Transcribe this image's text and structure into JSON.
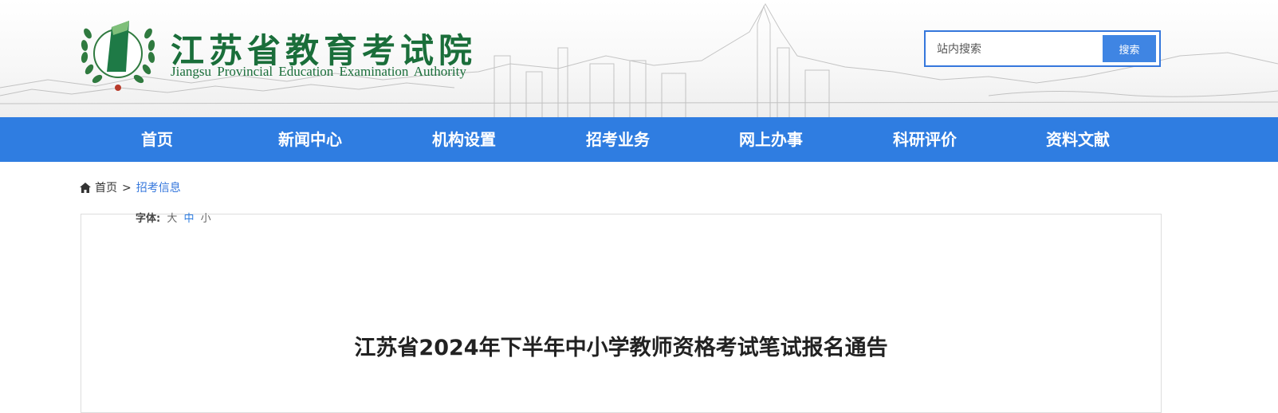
{
  "header": {
    "title_cn": "江苏省教育考试院",
    "title_en": "Jiangsu Provincial Education Examination Authority"
  },
  "search": {
    "placeholder": "站内搜索",
    "button_label": "搜索"
  },
  "nav": {
    "items": [
      "首页",
      "新闻中心",
      "机构设置",
      "招考业务",
      "网上办事",
      "科研评价",
      "资料文献"
    ]
  },
  "breadcrumb": {
    "home": "首页",
    "separator": ">",
    "current": "招考信息"
  },
  "font_size": {
    "label": "字体:",
    "large": "大",
    "medium": "中",
    "small": "小"
  },
  "article": {
    "title": "江苏省2024年下半年中小学教师资格考试笔试报名通告"
  },
  "colors": {
    "brand_blue": "#2f7de1",
    "logo_green": "#1a6e3a"
  }
}
